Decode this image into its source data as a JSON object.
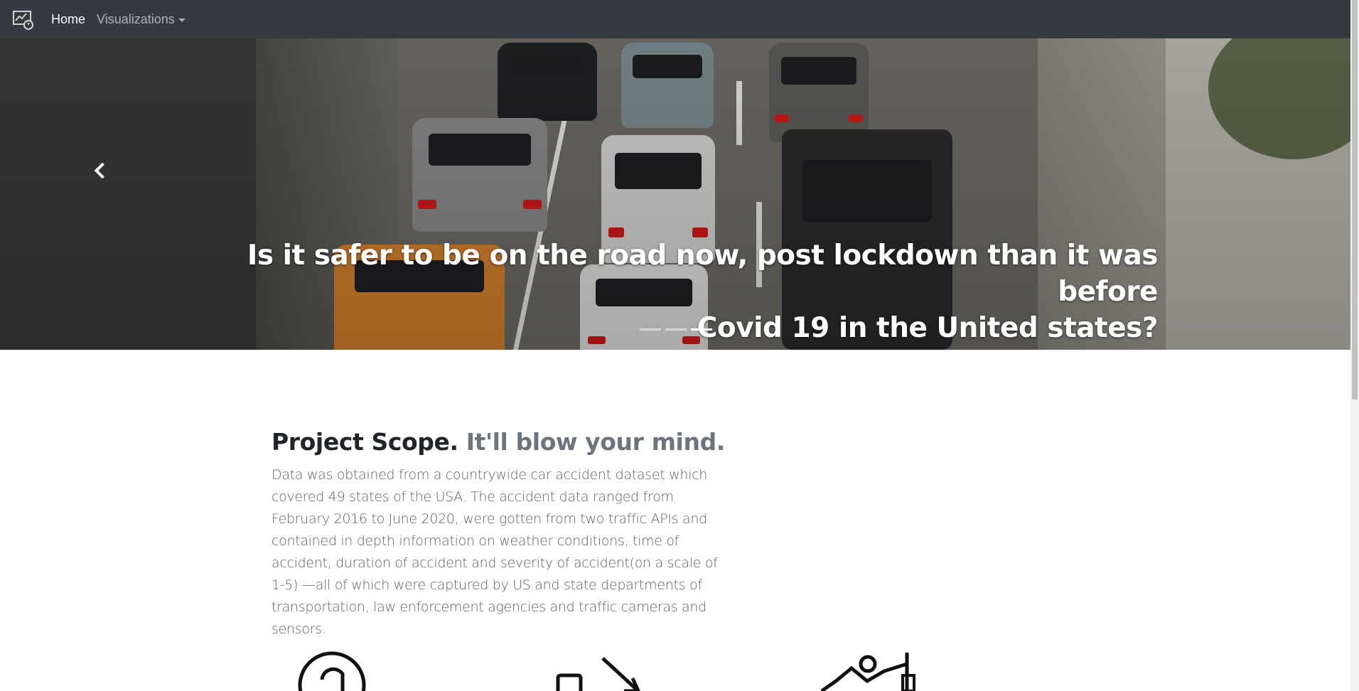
{
  "navbar": {
    "brand_icon": "dashboard-chart-logo-icon",
    "home_label": "Home",
    "visualizations_label": "Visualizations"
  },
  "hero": {
    "caption_line1": "Is it safer to be on the road now, post lockdown than it was before",
    "caption_line2": "Covid 19 in the United states?",
    "prev_icon": "chevron-left-icon",
    "active_slide": 2,
    "slide_count": 3
  },
  "scope": {
    "heading": "Project Scope.",
    "heading_muted": "It'll blow your mind.",
    "text": "Data was obtained from a countrywide car accident dataset which covered 49 states of the USA. The accident data ranged from February 2016 to June 2020, were gotten from two traffic APIs and contained in depth information on weather conditions, time of accident, duration of accident and severity of accident(on a scale of 1-5) —all of which were captured by US and state departments of transportation, law enforcement agencies and traffic cameras and sensors."
  },
  "features": {
    "icons": [
      "clock-icon",
      "trending-down-icon",
      "line-chart-icon"
    ]
  },
  "colors": {
    "navbar_bg": "#343a40",
    "text_dark": "#212529",
    "text_muted": "#6c757d"
  }
}
